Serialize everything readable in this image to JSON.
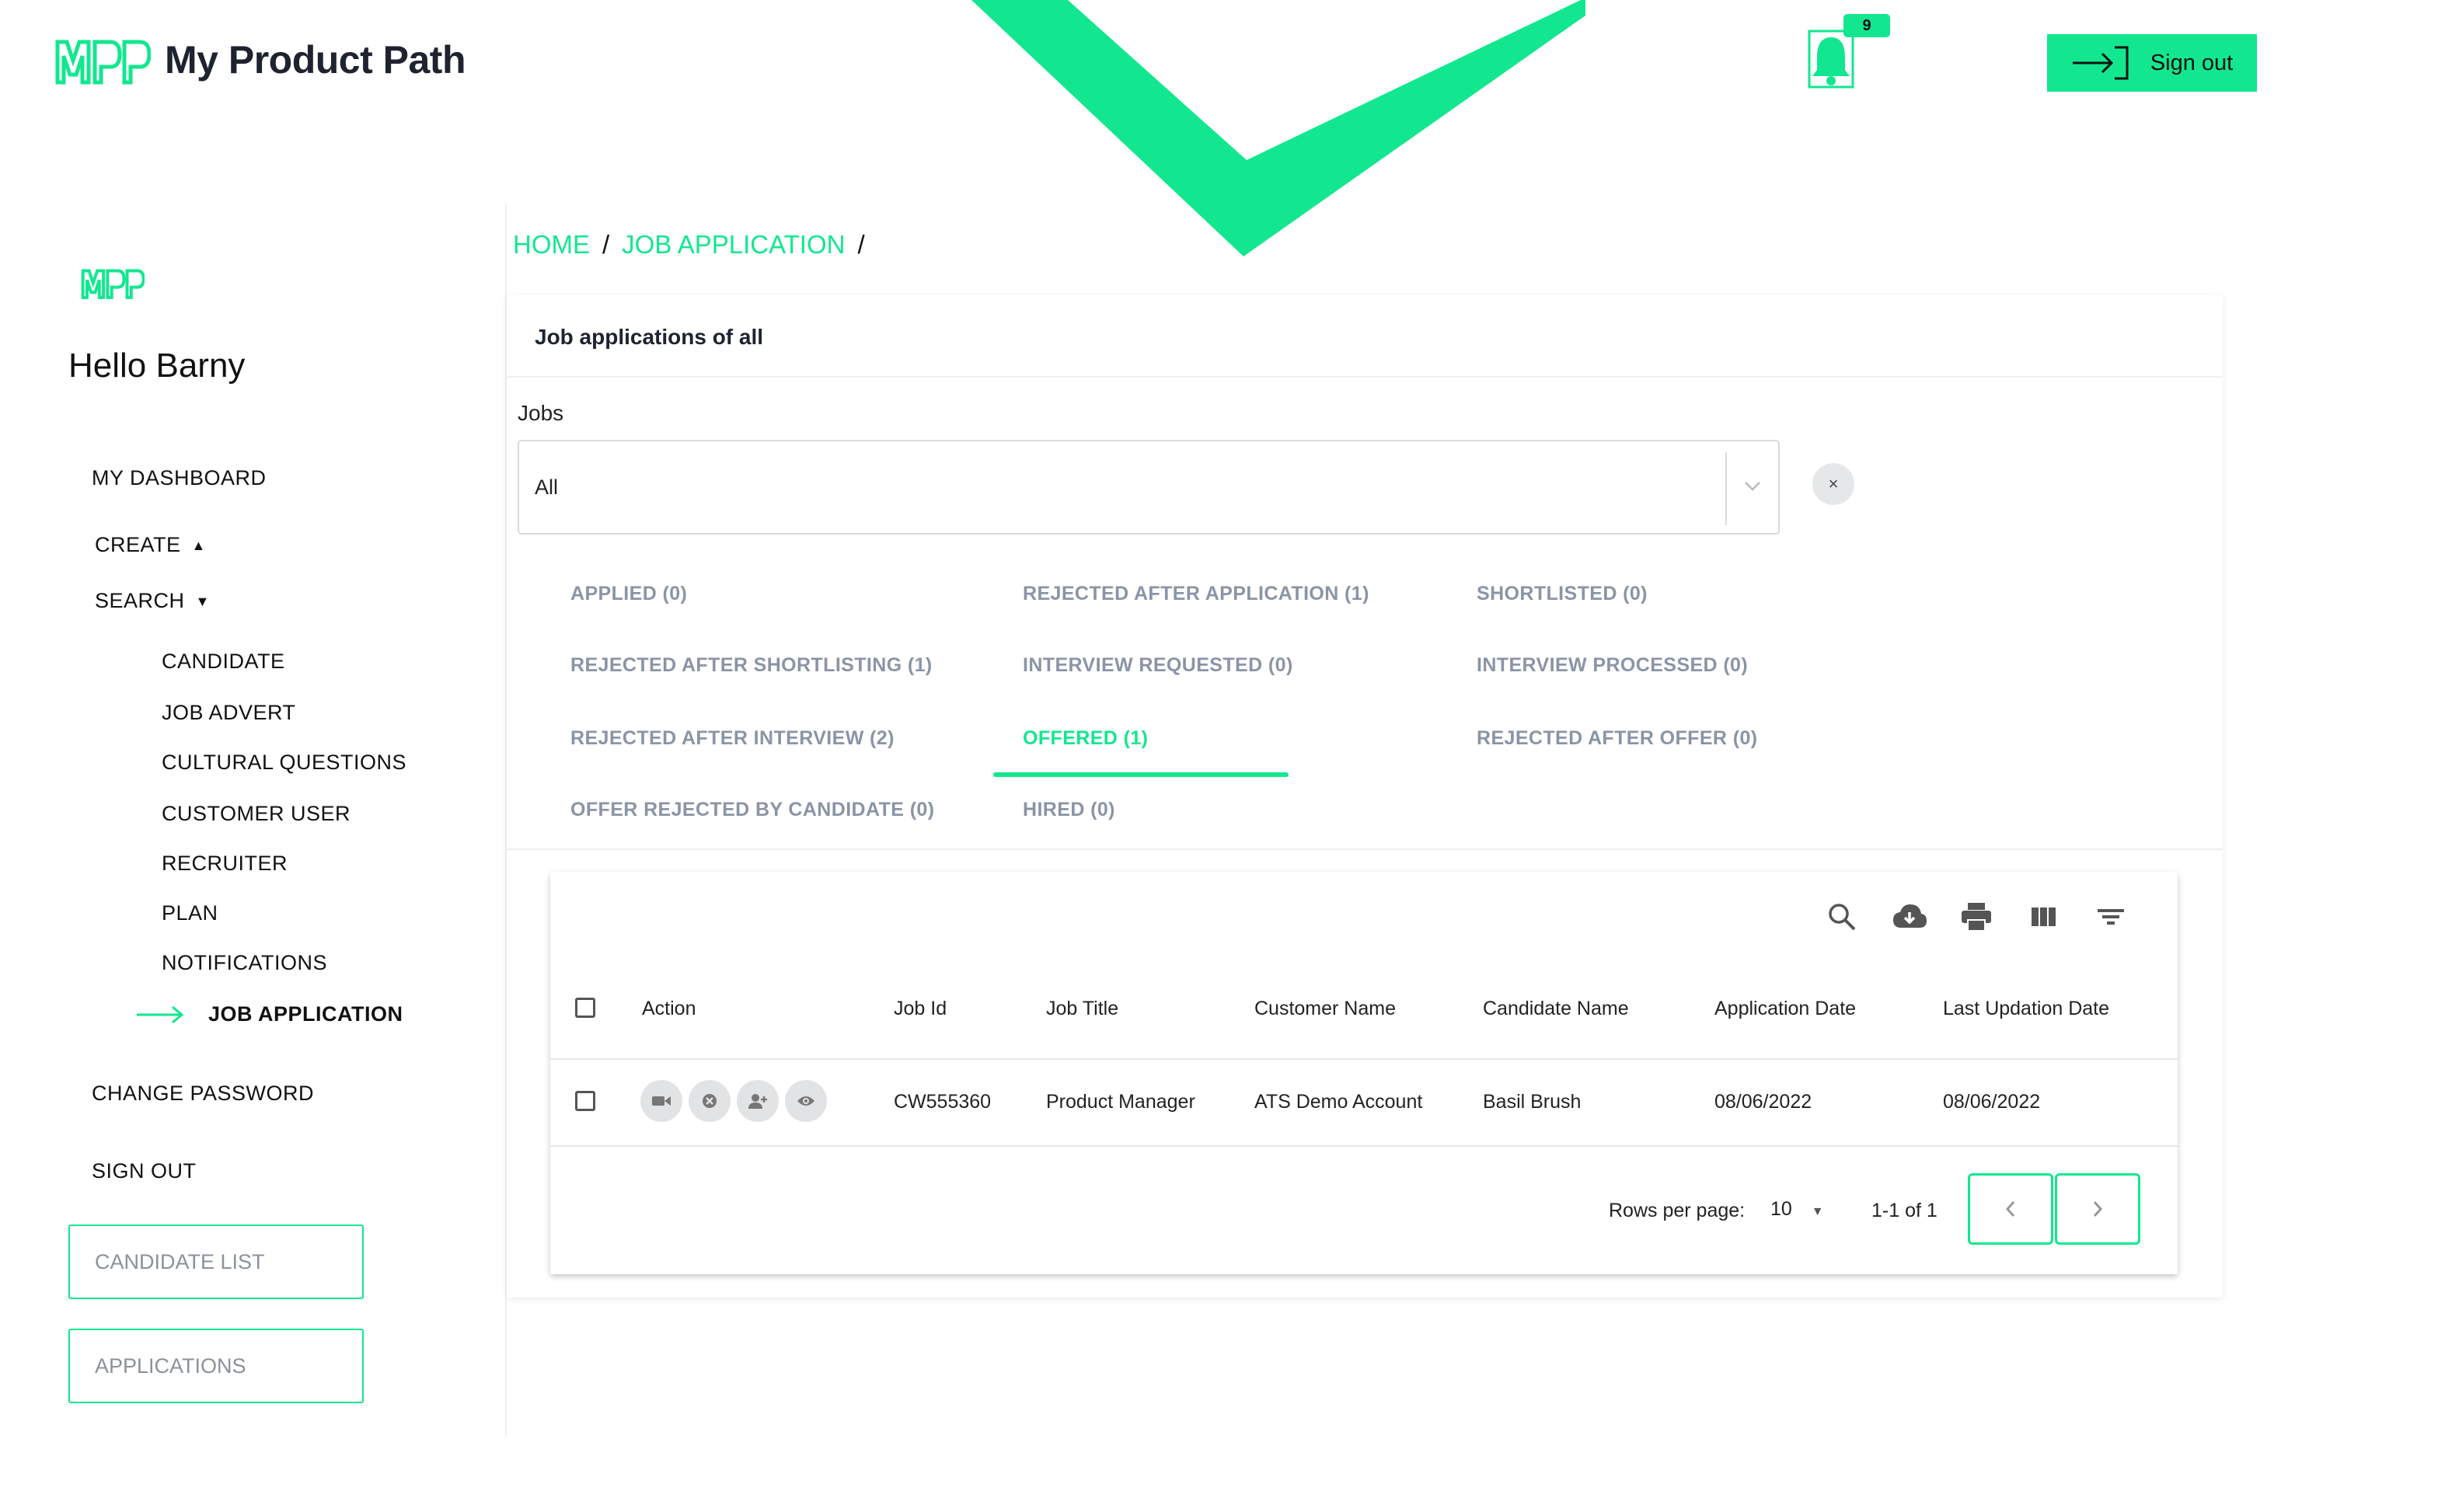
{
  "header": {
    "logo_text": "MPP",
    "brand_name": "My Product Path",
    "notification_count": "9",
    "sign_out_label": "Sign out"
  },
  "sidebar": {
    "logo_text": "MPP",
    "greeting": "Hello Barny",
    "items": [
      {
        "label": "MY DASHBOARD"
      },
      {
        "label": "CREATE"
      },
      {
        "label": "SEARCH"
      },
      {
        "label": "CHANGE PASSWORD"
      },
      {
        "label": "SIGN OUT"
      }
    ],
    "sub_items": [
      {
        "label": "CANDIDATE"
      },
      {
        "label": "JOB ADVERT"
      },
      {
        "label": "CULTURAL QUESTIONS"
      },
      {
        "label": "CUSTOMER USER"
      },
      {
        "label": "RECRUITER"
      },
      {
        "label": "PLAN"
      },
      {
        "label": "NOTIFICATIONS"
      },
      {
        "label": "JOB APPLICATION",
        "active": true
      }
    ],
    "buttons": [
      {
        "label": "CANDIDATE LIST"
      },
      {
        "label": "APPLICATIONS"
      }
    ]
  },
  "breadcrumb": {
    "items": [
      "HOME",
      "JOB APPLICATION"
    ],
    "separator": "/"
  },
  "panel": {
    "title": "Job applications of all",
    "jobs_label": "Jobs",
    "jobs_value": "All",
    "clear_label": "×"
  },
  "tabs": [
    {
      "label": "APPLIED (0)"
    },
    {
      "label": "REJECTED AFTER APPLICATION (1)"
    },
    {
      "label": "SHORTLISTED (0)"
    },
    {
      "label": "REJECTED AFTER SHORTLISTING (1)"
    },
    {
      "label": "INTERVIEW REQUESTED (0)"
    },
    {
      "label": "INTERVIEW PROCESSED (0)"
    },
    {
      "label": "REJECTED AFTER INTERVIEW (2)"
    },
    {
      "label": "OFFERED (1)",
      "active": true
    },
    {
      "label": "REJECTED AFTER OFFER (0)"
    },
    {
      "label": "OFFER REJECTED BY CANDIDATE (0)"
    },
    {
      "label": "HIRED (0)"
    }
  ],
  "table": {
    "toolbar_icons": [
      "search-icon",
      "cloud-download-icon",
      "print-icon",
      "view-columns-icon",
      "filter-icon"
    ],
    "columns": [
      "Action",
      "Job Id",
      "Job Title",
      "Customer Name",
      "Candidate Name",
      "Application Date",
      "Last Updation Date"
    ],
    "rows": [
      {
        "action_icons": [
          "video-icon",
          "cancel-icon",
          "person-add-icon",
          "view-icon"
        ],
        "job_id": "CW555360",
        "job_title": "Product Manager",
        "customer_name": "ATS Demo Account",
        "candidate_name": "Basil Brush",
        "application_date": "08/06/2022",
        "last_updation_date": "08/06/2022"
      }
    ],
    "pagination": {
      "rows_per_page_label": "Rows per page:",
      "rows_per_page_value": "10",
      "range": "1-1 of 1"
    }
  },
  "colors": {
    "accent": "#12e78f",
    "text": "#1f2330",
    "tab_inactive": "#8b94a6"
  }
}
